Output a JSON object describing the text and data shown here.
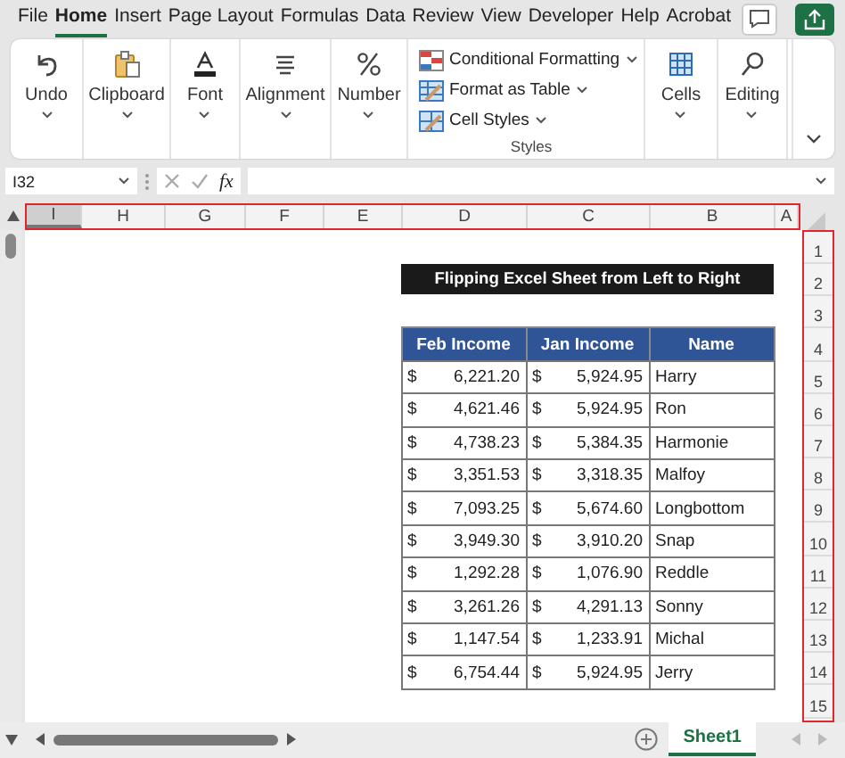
{
  "ribbon_tabs": [
    {
      "label": "File",
      "selected": false
    },
    {
      "label": "Home",
      "selected": true
    },
    {
      "label": "Insert",
      "selected": false
    },
    {
      "label": "Page Layout",
      "selected": false
    },
    {
      "label": "Formulas",
      "selected": false
    },
    {
      "label": "Data",
      "selected": false
    },
    {
      "label": "Review",
      "selected": false
    },
    {
      "label": "View",
      "selected": false
    },
    {
      "label": "Developer",
      "selected": false
    },
    {
      "label": "Help",
      "selected": false
    },
    {
      "label": "Acrobat",
      "selected": false
    }
  ],
  "ribbon_groups": [
    {
      "kind": "button",
      "label": "Undo"
    },
    {
      "kind": "button",
      "label": "Clipboard"
    },
    {
      "kind": "button",
      "label": "Font"
    },
    {
      "kind": "button",
      "label": "Alignment"
    },
    {
      "kind": "button",
      "label": "Number"
    },
    {
      "kind": "list",
      "label": "Styles",
      "items": [
        "Conditional Formatting",
        "Format as Table",
        "Cell Styles"
      ]
    },
    {
      "kind": "button",
      "label": "Cells"
    },
    {
      "kind": "button",
      "label": "Editing"
    }
  ],
  "name_box": "I32",
  "function_label": "fx",
  "column_headers": {
    "highlighted": true,
    "items": [
      {
        "label": "I",
        "selected": true
      },
      {
        "label": "H",
        "selected": false
      },
      {
        "label": "G",
        "selected": false
      },
      {
        "label": "F",
        "selected": false
      },
      {
        "label": "E",
        "selected": false
      },
      {
        "label": "D",
        "selected": false
      },
      {
        "label": "C",
        "selected": false
      },
      {
        "label": "B",
        "selected": false
      },
      {
        "label": "A",
        "selected": false
      }
    ]
  },
  "row_headers": {
    "highlighted": true,
    "items": [
      "1",
      "2",
      "3",
      "4",
      "5",
      "6",
      "7",
      "8",
      "9",
      "10",
      "11",
      "12",
      "13",
      "14",
      "15"
    ]
  },
  "title": "Flipping Excel Sheet from Left to Right",
  "table": {
    "columns": [
      "Feb Income",
      "Jan Income",
      "Name"
    ],
    "rows": [
      {
        "feb_currency": "$",
        "feb": "6,221.20",
        "jan_currency": "$",
        "jan": "5,924.95",
        "name": "Harry"
      },
      {
        "feb_currency": "$",
        "feb": "4,621.46",
        "jan_currency": "$",
        "jan": "5,924.95",
        "name": "Ron"
      },
      {
        "feb_currency": "$",
        "feb": "4,738.23",
        "jan_currency": "$",
        "jan": "5,384.35",
        "name": "Harmonie"
      },
      {
        "feb_currency": "$",
        "feb": "3,351.53",
        "jan_currency": "$",
        "jan": "3,318.35",
        "name": "Malfoy"
      },
      {
        "feb_currency": "$",
        "feb": "7,093.25",
        "jan_currency": "$",
        "jan": "5,674.60",
        "name": "Longbottom"
      },
      {
        "feb_currency": "$",
        "feb": "3,949.30",
        "jan_currency": "$",
        "jan": "3,910.20",
        "name": "Snap"
      },
      {
        "feb_currency": "$",
        "feb": "1,292.28",
        "jan_currency": "$",
        "jan": "1,076.90",
        "name": "Reddle"
      },
      {
        "feb_currency": "$",
        "feb": "3,261.26",
        "jan_currency": "$",
        "jan": "4,291.13",
        "name": "Sonny"
      },
      {
        "feb_currency": "$",
        "feb": "1,147.54",
        "jan_currency": "$",
        "jan": "1,233.91",
        "name": "Michal"
      },
      {
        "feb_currency": "$",
        "feb": "6,754.44",
        "jan_currency": "$",
        "jan": "5,924.95",
        "name": "Jerry"
      }
    ]
  },
  "sheet_tabs": [
    {
      "label": "Sheet1",
      "selected": true
    }
  ]
}
